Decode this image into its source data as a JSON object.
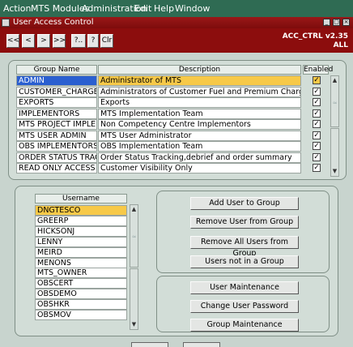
{
  "menu": {
    "items": [
      "Action",
      "MTS Modules",
      "Administration",
      "Edit",
      "Help",
      "Window"
    ]
  },
  "window": {
    "title": "User Access Control"
  },
  "toolbar": {
    "buttons": [
      "<<",
      "<",
      ">",
      ">>",
      "?..",
      "?",
      "Clr"
    ],
    "form_code": "ACC_CTRL v2.35",
    "form_scope": "ALL"
  },
  "groups": {
    "headers": {
      "name": "Group Name",
      "description": "Description",
      "enabled": "Enabled"
    },
    "rows": [
      {
        "name": "ADMIN",
        "description": "Administrator of MTS",
        "enabled": true
      },
      {
        "name": "CUSTOMER_CHARGES",
        "description": "Administrators of Customer Fuel and Premium Charges",
        "enabled": true
      },
      {
        "name": "EXPORTS",
        "description": "Exports",
        "enabled": true
      },
      {
        "name": "IMPLEMENTORS",
        "description": "MTS Implementation Team",
        "enabled": true
      },
      {
        "name": "MTS PROJECT IMPLEM",
        "description": "Non Competency Centre Implementors",
        "enabled": true
      },
      {
        "name": "MTS USER ADMIN",
        "description": "MTS User Administrator",
        "enabled": true
      },
      {
        "name": "OBS IMPLEMENTORS",
        "description": "OBS Implementation Team",
        "enabled": true
      },
      {
        "name": "ORDER STATUS TRAC",
        "description": "Order Status Tracking,debrief and order summary",
        "enabled": true
      },
      {
        "name": "READ ONLY ACCESS",
        "description": "Customer Visibility Only",
        "enabled": true
      }
    ]
  },
  "users": {
    "header": "Username",
    "rows": [
      "DNGTESCO",
      "GREERP",
      "HICKSONJ",
      "LENNY",
      "MEIRD",
      "MENONS",
      "MTS_OWNER",
      "OBSCERT",
      "OBSDEMO",
      "OBSHKR",
      "OBSMOV"
    ]
  },
  "group_actions": {
    "add": "Add User to Group",
    "remove": "Remove User from Group",
    "remove_all": "Remove All Users from Group",
    "not_in_group": "Users not in a Group"
  },
  "maintenance": {
    "user": "User Maintenance",
    "password": "Change User Password",
    "group": "Group Maintenance"
  },
  "colors": {
    "menubar": "#2f6b53",
    "titlebar": "#8c0d0d",
    "selected_row": "#f7c948",
    "current_cell": "#2a5fd0",
    "panel": "#d2ddd7"
  }
}
